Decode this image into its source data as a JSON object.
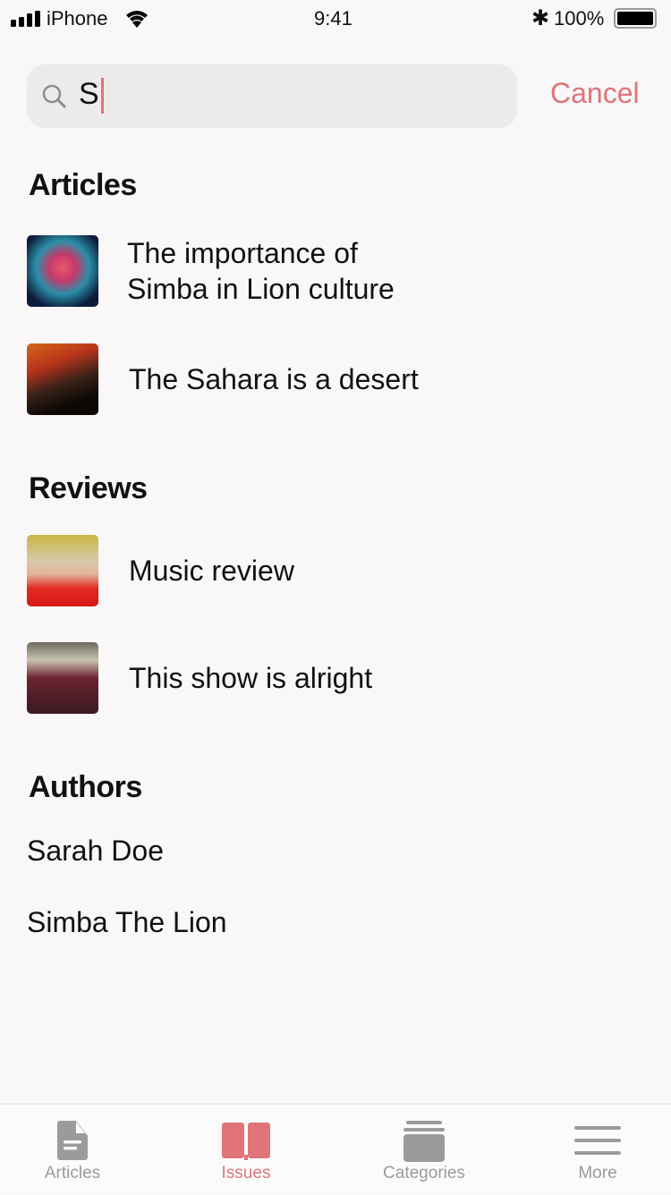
{
  "status_bar": {
    "carrier": "iPhone",
    "time": "9:41",
    "battery": "100%"
  },
  "search": {
    "query": "S",
    "cancel_label": "Cancel"
  },
  "sections": {
    "articles": {
      "title": "Articles",
      "items": [
        {
          "title_line1": "The importance of",
          "title_line2": "Simba in Lion culture"
        },
        {
          "title": "The Sahara is a desert"
        }
      ]
    },
    "reviews": {
      "title": "Reviews",
      "items": [
        {
          "title": "Music review"
        },
        {
          "title": "This show is alright"
        }
      ]
    },
    "authors": {
      "title": "Authors",
      "items": [
        "Sarah Doe",
        "Simba The Lion"
      ]
    }
  },
  "tabbar": {
    "items": [
      {
        "label": "Articles",
        "icon": "document-icon"
      },
      {
        "label": "Issues",
        "icon": "book-icon",
        "active": true
      },
      {
        "label": "Categories",
        "icon": "stack-icon"
      },
      {
        "label": "More",
        "icon": "menu-icon"
      }
    ]
  },
  "colors": {
    "accent": "#e07479",
    "inactive": "#9b9b9b"
  }
}
